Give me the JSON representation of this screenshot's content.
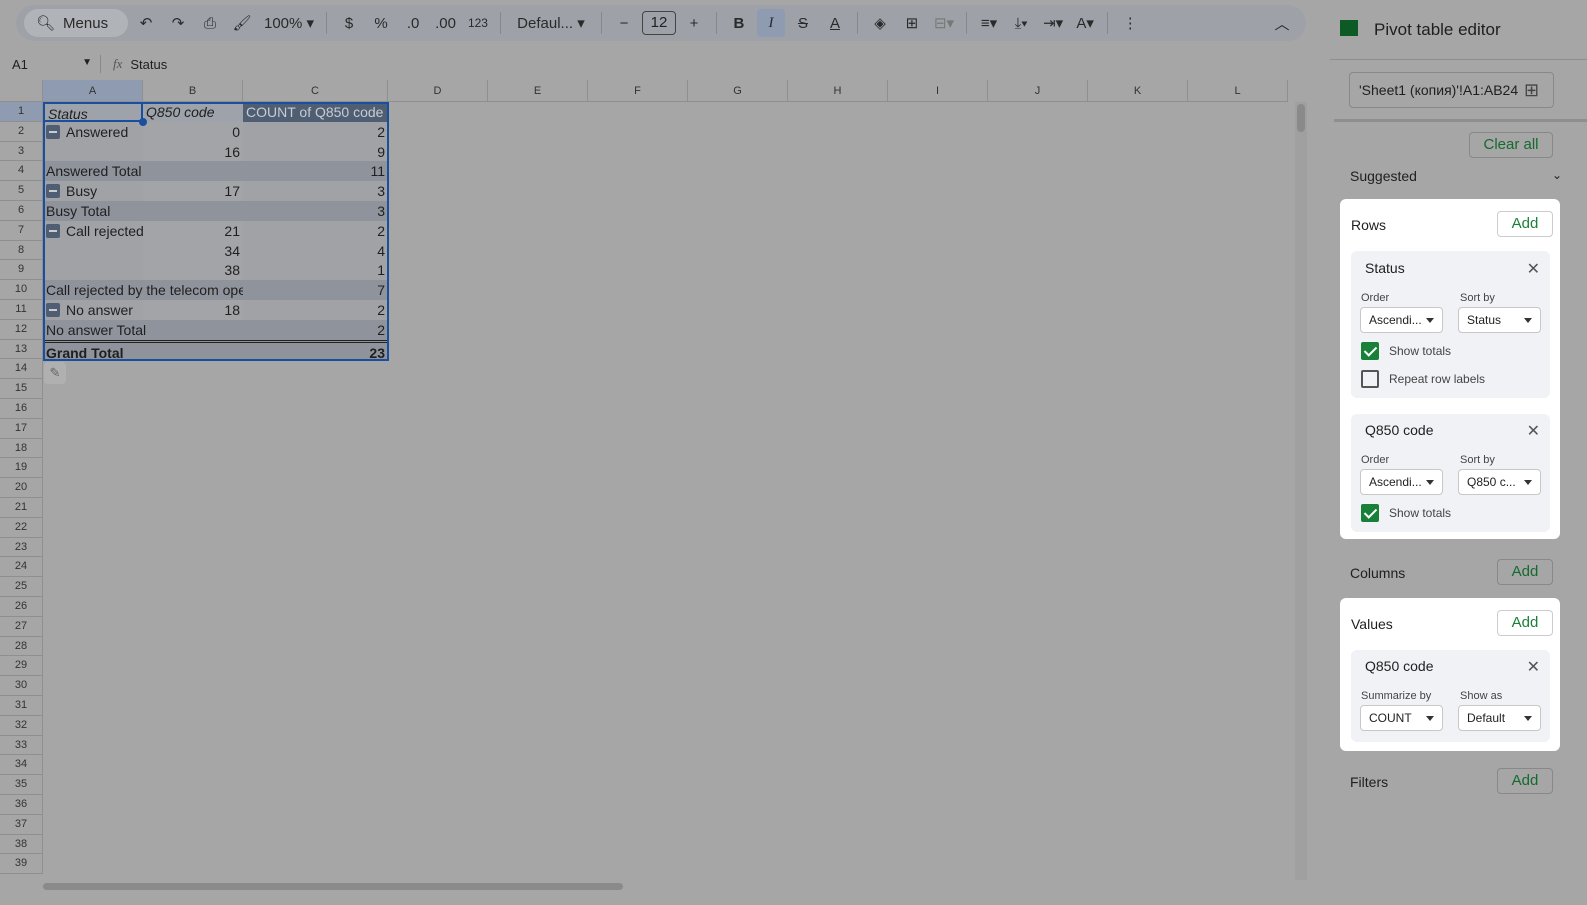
{
  "toolbar": {
    "search": "Menus",
    "zoom": "100%",
    "currency": "$",
    "percent": "%",
    "dec_minus": ".0",
    "dec_plus": ".00",
    "format": "123",
    "font": "Defaul...",
    "font_size": "12",
    "bold": "B",
    "italic": "I"
  },
  "formula_bar": {
    "cell_ref": "A1",
    "fx": "fx",
    "value": "Status"
  },
  "columns": [
    "A",
    "B",
    "C",
    "D",
    "E",
    "F",
    "G",
    "H",
    "I",
    "J",
    "K",
    "L"
  ],
  "row_count": 39,
  "pivot": {
    "header": [
      "Status",
      "Q850 code",
      "COUNT of Q850 code"
    ],
    "rows": [
      {
        "a": "Answered",
        "b": "0",
        "c": "2",
        "group": true
      },
      {
        "a": "",
        "b": "16",
        "c": "9"
      },
      {
        "a": "Answered Total",
        "b": "",
        "c": "11",
        "total": true
      },
      {
        "a": "Busy",
        "b": "17",
        "c": "3",
        "group": true
      },
      {
        "a": "Busy Total",
        "b": "",
        "c": "3",
        "total": true
      },
      {
        "a": "Call rejected",
        "b": "21",
        "c": "2",
        "group": true
      },
      {
        "a": "",
        "b": "34",
        "c": "4"
      },
      {
        "a": "",
        "b": "38",
        "c": "1"
      },
      {
        "a": "Call rejected by the telecom operator Total",
        "b": "",
        "c": "7",
        "total": true
      },
      {
        "a": "No answer",
        "b": "18",
        "c": "2",
        "group": true
      },
      {
        "a": "No answer Total",
        "b": "",
        "c": "2",
        "total": true
      },
      {
        "a": "Grand Total",
        "b": "",
        "c": "23",
        "grand": true
      }
    ]
  },
  "editor": {
    "title": "Pivot table editor",
    "range": "'Sheet1 (копия)'!A1:AB24",
    "clear_all": "Clear all",
    "suggested": "Suggested",
    "rows_label": "Rows",
    "add": "Add",
    "columns_label": "Columns",
    "values_label": "Values",
    "filters_label": "Filters",
    "status": {
      "name": "Status",
      "order_label": "Order",
      "order": "Ascendi...",
      "sort_label": "Sort by",
      "sort": "Status",
      "show_totals": "Show totals",
      "repeat": "Repeat row labels"
    },
    "q850": {
      "name": "Q850 code",
      "order_label": "Order",
      "order": "Ascendi...",
      "sort_label": "Sort by",
      "sort": "Q850 c...",
      "show_totals": "Show totals"
    },
    "value": {
      "name": "Q850 code",
      "summarize_label": "Summarize by",
      "summarize": "COUNT",
      "show_as_label": "Show as",
      "show_as": "Default"
    }
  }
}
